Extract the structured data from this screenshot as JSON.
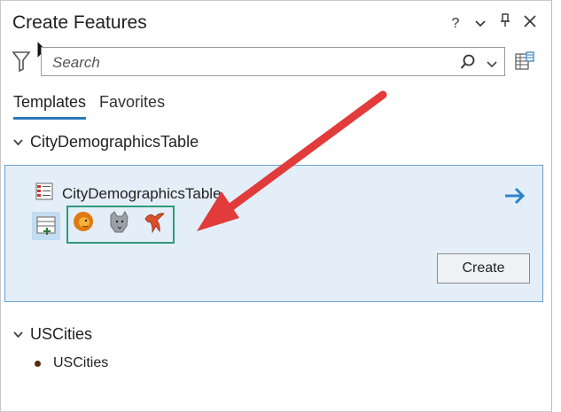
{
  "window": {
    "title": "Create Features",
    "controls": {
      "help": "?",
      "menu": "⌄",
      "pin": "📌",
      "close": "✕"
    }
  },
  "search": {
    "placeholder": "Search",
    "value": ""
  },
  "tabs": [
    {
      "label": "Templates",
      "active": true
    },
    {
      "label": "Favorites",
      "active": false
    }
  ],
  "groups": [
    {
      "name": "CityDemographicsTable",
      "expanded": true,
      "templates": [
        {
          "name": "CityDemographicsTable",
          "selected": true,
          "icon": "table-icon",
          "tools": [
            "new-row-tool-icon",
            "lion-icon",
            "wolf-icon",
            "bird-icon"
          ],
          "create_label": "Create"
        }
      ]
    },
    {
      "name": "USCities",
      "expanded": true,
      "templates": [
        {
          "name": "USCities",
          "icon": "point-symbol-icon"
        }
      ]
    }
  ],
  "colors": {
    "accent": "#2a7ab8",
    "selected_bg": "#e3eef8",
    "highlight_box": "#2e9a7a",
    "annotation_arrow": "#e23b3b"
  }
}
